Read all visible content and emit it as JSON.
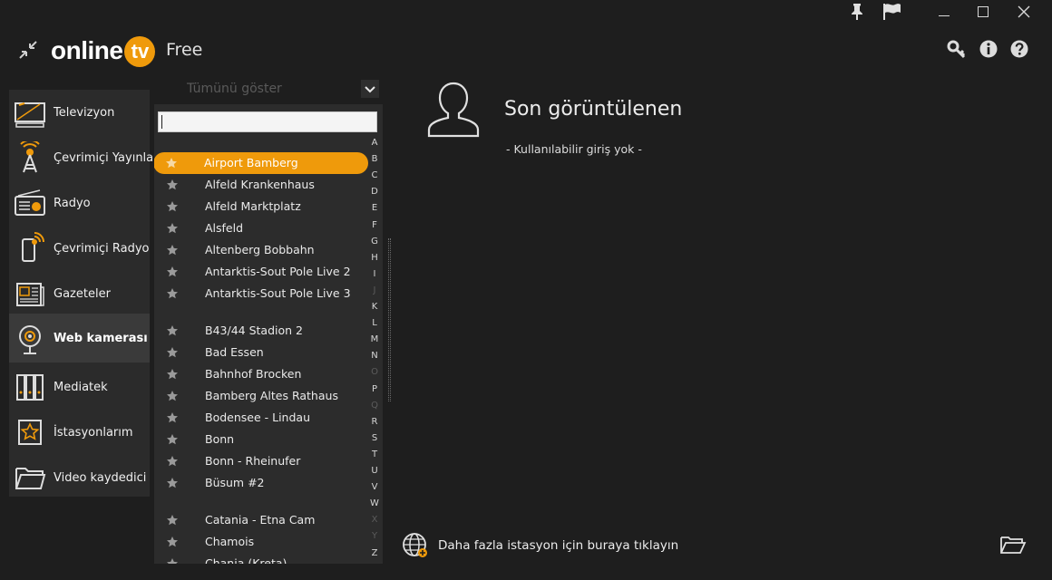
{
  "app": {
    "logo_main": "online",
    "logo_badge": "tv",
    "edition": "Free"
  },
  "sidebar": {
    "items": [
      {
        "label": "Televizyon",
        "icon": "tv-icon"
      },
      {
        "label": "Çevrimiçi Yayınlar",
        "icon": "broadcast-tower-icon"
      },
      {
        "label": "Radyo",
        "icon": "radio-icon"
      },
      {
        "label": "Çevrimiçi Radyo",
        "icon": "phone-radio-icon"
      },
      {
        "label": "Gazeteler",
        "icon": "newspaper-icon"
      },
      {
        "label": "Web kamerası",
        "icon": "webcam-icon",
        "active": true
      },
      {
        "label": "Mediatek",
        "icon": "media-library-icon"
      },
      {
        "label": "İstasyonlarım",
        "icon": "star-icon"
      },
      {
        "label": "Video kaydedici",
        "icon": "folder-icon"
      }
    ]
  },
  "filter": {
    "selected": "Tümünü göster"
  },
  "search": {
    "value": ""
  },
  "stations": [
    {
      "name": "Airport Bamberg",
      "selected": true
    },
    {
      "name": "Alfeld Krankenhaus"
    },
    {
      "name": "Alfeld Marktplatz"
    },
    {
      "name": "Alsfeld"
    },
    {
      "name": "Altenberg Bobbahn"
    },
    {
      "name": "Antarktis-Sout Pole Live 2"
    },
    {
      "name": "Antarktis-Sout Pole Live 3"
    },
    {
      "name": "B43/44 Stadion 2"
    },
    {
      "name": "Bad Essen"
    },
    {
      "name": "Bahnhof Brocken"
    },
    {
      "name": "Bamberg Altes Rathaus"
    },
    {
      "name": "Bodensee - Lindau"
    },
    {
      "name": "Bonn"
    },
    {
      "name": "Bonn - Rheinufer"
    },
    {
      "name": "Büsum #2"
    },
    {
      "name": "Catania - Etna Cam"
    },
    {
      "name": "Chamois"
    },
    {
      "name": "Chania (Kreta)"
    }
  ],
  "alphabet": [
    {
      "letter": "A",
      "enabled": true
    },
    {
      "letter": "B",
      "enabled": true
    },
    {
      "letter": "C",
      "enabled": true
    },
    {
      "letter": "D",
      "enabled": true
    },
    {
      "letter": "E",
      "enabled": true
    },
    {
      "letter": "F",
      "enabled": true
    },
    {
      "letter": "G",
      "enabled": true
    },
    {
      "letter": "H",
      "enabled": true
    },
    {
      "letter": "I",
      "enabled": true
    },
    {
      "letter": "J",
      "enabled": false
    },
    {
      "letter": "K",
      "enabled": true
    },
    {
      "letter": "L",
      "enabled": true
    },
    {
      "letter": "M",
      "enabled": true
    },
    {
      "letter": "N",
      "enabled": true
    },
    {
      "letter": "O",
      "enabled": false
    },
    {
      "letter": "P",
      "enabled": true
    },
    {
      "letter": "Q",
      "enabled": false
    },
    {
      "letter": "R",
      "enabled": true
    },
    {
      "letter": "S",
      "enabled": true
    },
    {
      "letter": "T",
      "enabled": true
    },
    {
      "letter": "U",
      "enabled": true
    },
    {
      "letter": "V",
      "enabled": true
    },
    {
      "letter": "W",
      "enabled": true
    },
    {
      "letter": "X",
      "enabled": false
    },
    {
      "letter": "Y",
      "enabled": false
    },
    {
      "letter": "Z",
      "enabled": true
    }
  ],
  "recent": {
    "title": "Son görüntülenen",
    "empty_text": "- Kullanılabilir giriş yok -"
  },
  "footer": {
    "more_stations": "Daha fazla istasyon için buraya tıklayın"
  },
  "colors": {
    "accent": "#ef9a0b",
    "background": "#1e1e1e",
    "panel": "#2b2b2b"
  }
}
